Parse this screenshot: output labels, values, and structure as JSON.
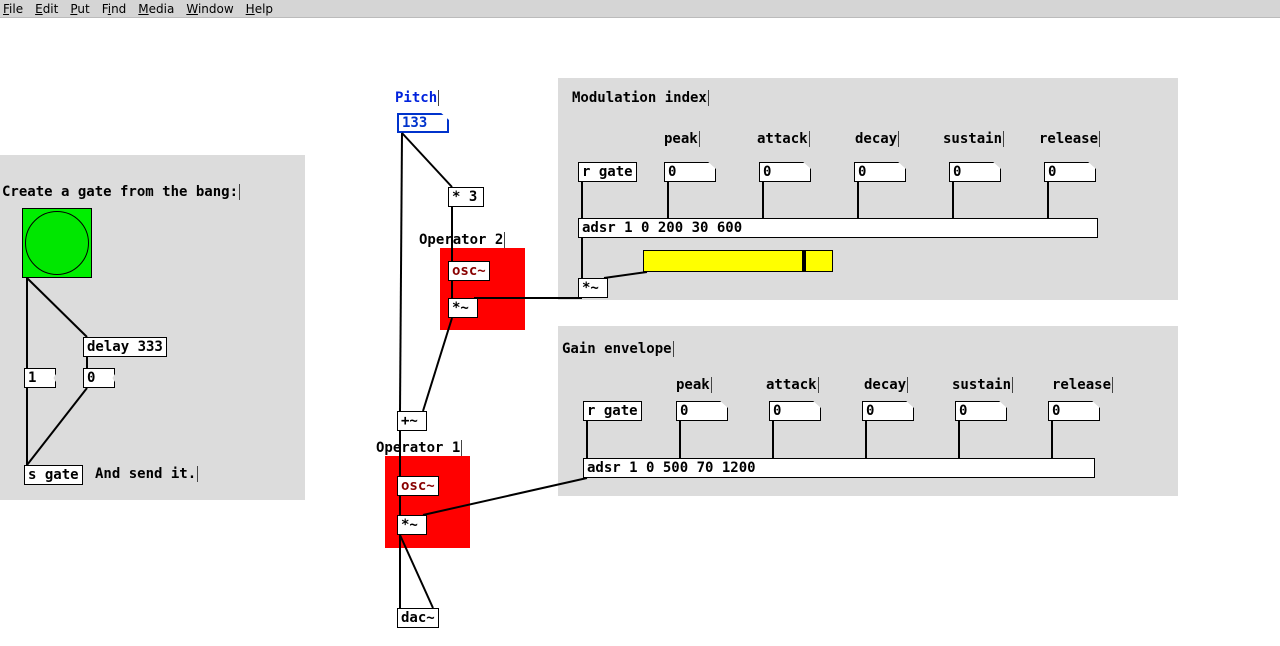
{
  "menu": {
    "items": [
      "File",
      "Edit",
      "Put",
      "Find",
      "Media",
      "Window",
      "Help"
    ]
  },
  "left": {
    "title": "Create a gate from the bang:",
    "delay": "delay 333",
    "msg1": "1",
    "msg0": "0",
    "send": "s gate",
    "send_hint": "And send it."
  },
  "pitch": {
    "label": "Pitch",
    "value": "133",
    "mult": "* 3"
  },
  "op2": {
    "label": "Operator 2",
    "osc": "osc~",
    "mul": "*~"
  },
  "sum": "+~",
  "op1": {
    "label": "Operator 1",
    "osc": "osc~",
    "mul": "*~"
  },
  "dac": "dac~",
  "mod": {
    "title": "Modulation index",
    "labels": {
      "peak": "peak",
      "attack": "attack",
      "decay": "decay",
      "sustain": "sustain",
      "release": "release"
    },
    "rgate": "r gate",
    "vals": {
      "peak": "0",
      "attack": "0",
      "decay": "0",
      "sustain": "0",
      "release": "0"
    },
    "adsr": "adsr 1 0 200 30 600",
    "mul": "*~"
  },
  "gain": {
    "title": "Gain envelope",
    "labels": {
      "peak": "peak",
      "attack": "attack",
      "decay": "decay",
      "sustain": "sustain",
      "release": "release"
    },
    "rgate": "r gate",
    "vals": {
      "peak": "0",
      "attack": "0",
      "decay": "0",
      "sustain": "0",
      "release": "0"
    },
    "adsr": "adsr 1 0 500 70 1200"
  }
}
